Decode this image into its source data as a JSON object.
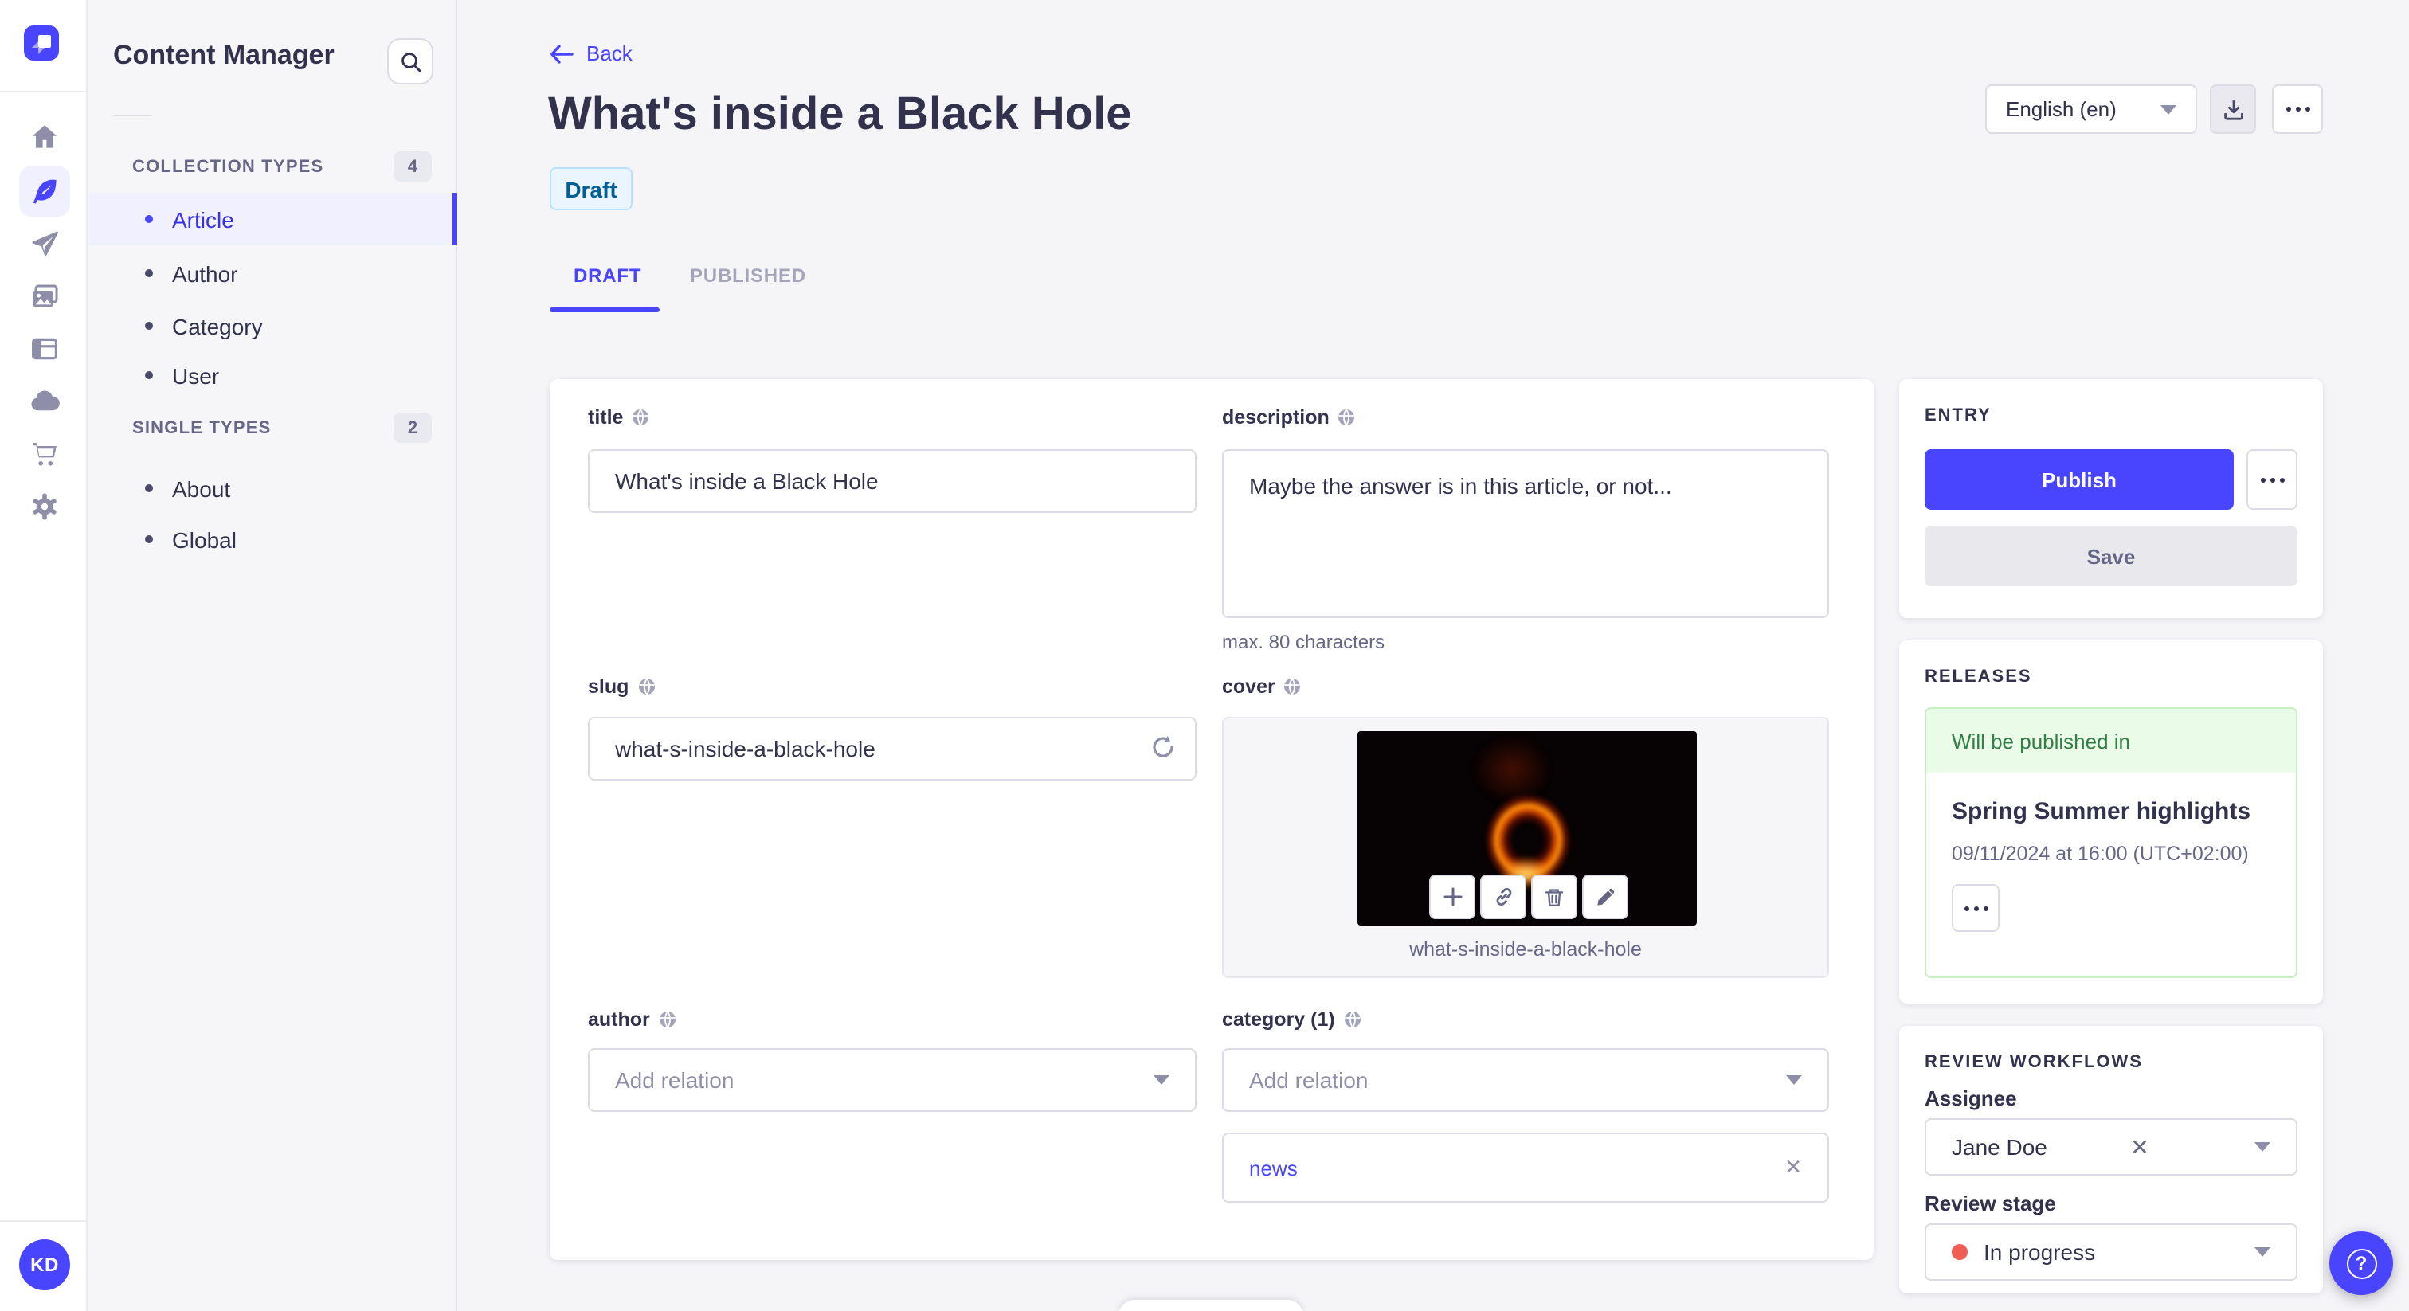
{
  "colors": {
    "accent": "#4945ff",
    "accent_dark": "#271fe0",
    "draft_bg": "#eaf5ff",
    "draft_text": "#006096",
    "success_bg": "#eafbe7",
    "success_text": "#328048",
    "danger_dot": "#ee5e52",
    "neutral_text": "#32324d",
    "muted_text": "#666687"
  },
  "rail": {
    "logo_icon": "strapi-logo",
    "items": [
      {
        "icon": "home-icon"
      },
      {
        "icon": "content-manager-feather-icon",
        "active": true
      },
      {
        "icon": "transfer-paper-plane-icon"
      },
      {
        "icon": "media-library-icon"
      },
      {
        "icon": "content-type-builder-icon"
      },
      {
        "icon": "cloud-icon"
      },
      {
        "icon": "marketplace-cart-icon"
      },
      {
        "icon": "settings-gear-icon"
      }
    ],
    "user_initials": "KD"
  },
  "subnav": {
    "title": "Content Manager",
    "search_icon": "search-icon",
    "sections": [
      {
        "label": "COLLECTION TYPES",
        "count": "4",
        "items": [
          {
            "label": "Article",
            "active": true
          },
          {
            "label": "Author"
          },
          {
            "label": "Category"
          },
          {
            "label": "User"
          }
        ]
      },
      {
        "label": "SINGLE TYPES",
        "count": "2",
        "items": [
          {
            "label": "About"
          },
          {
            "label": "Global"
          }
        ]
      }
    ]
  },
  "header": {
    "back_label": "Back",
    "title": "What's inside a Black Hole",
    "status": "Draft",
    "locale": "English (en)"
  },
  "tabs": [
    {
      "label": "DRAFT",
      "active": true
    },
    {
      "label": "PUBLISHED",
      "active": false
    }
  ],
  "form": {
    "title": {
      "label": "title",
      "value": "What's inside a Black Hole"
    },
    "description": {
      "label": "description",
      "value": "Maybe the answer is in this article, or not...",
      "hint": "max. 80 characters"
    },
    "slug": {
      "label": "slug",
      "value": "what-s-inside-a-black-hole"
    },
    "cover": {
      "label": "cover",
      "caption": "what-s-inside-a-black-hole"
    },
    "author": {
      "label": "author",
      "placeholder": "Add relation"
    },
    "category": {
      "label": "category (1)",
      "placeholder": "Add relation",
      "relation": "news"
    }
  },
  "entry_panel": {
    "heading": "ENTRY",
    "publish_label": "Publish",
    "save_label": "Save"
  },
  "releases_panel": {
    "heading": "RELEASES",
    "status": "Will be published in",
    "release_title": "Spring Summer highlights",
    "release_date": "09/11/2024 at 16:00 (UTC+02:00)"
  },
  "review_panel": {
    "heading": "REVIEW WORKFLOWS",
    "assignee_label": "Assignee",
    "assignee_value": "Jane Doe",
    "stage_label": "Review stage",
    "stage_value": "In progress"
  }
}
